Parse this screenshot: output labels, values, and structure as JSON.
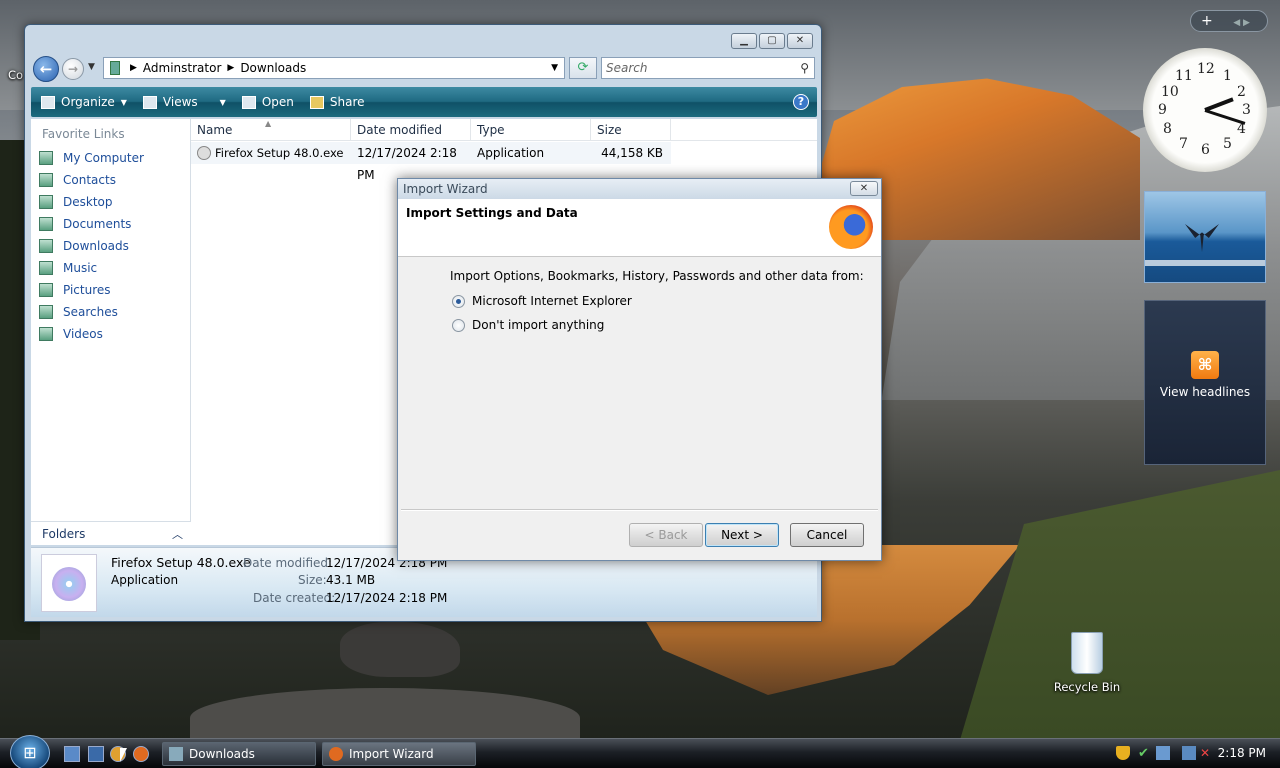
{
  "desktop": {
    "partial_icon_label": "Co",
    "recycle_bin": "Recycle Bin"
  },
  "explorer": {
    "breadcrumb": [
      "Adminstrator",
      "Downloads"
    ],
    "search_placeholder": "Search",
    "toolbar": {
      "organize": "Organize",
      "views": "Views",
      "open": "Open",
      "share": "Share"
    },
    "favorite_links_title": "Favorite Links",
    "links": [
      "My Computer",
      "Contacts",
      "Desktop",
      "Documents",
      "Downloads",
      "Music",
      "Pictures",
      "Searches",
      "Videos"
    ],
    "folders_label": "Folders",
    "columns": [
      "Name",
      "Date modified",
      "Type",
      "Size"
    ],
    "files": [
      {
        "name": "Firefox Setup 48.0.exe",
        "modified": "12/17/2024 2:18 PM",
        "type": "Application",
        "size": "44,158 KB"
      }
    ],
    "details": {
      "filename": "Firefox Setup 48.0.exe",
      "filetype": "Application",
      "date_modified_label": "Date modified:",
      "date_modified": "12/17/2024 2:18 PM",
      "size_label": "Size:",
      "size": "43.1 MB",
      "date_created_label": "Date created:",
      "date_created": "12/17/2024 2:18 PM"
    }
  },
  "wizard": {
    "title": "Import Wizard",
    "heading": "Import Settings and Data",
    "prompt": "Import Options, Bookmarks, History, Passwords and other data from:",
    "options": [
      {
        "label": "Microsoft Internet Explorer",
        "selected": true
      },
      {
        "label": "Don't import anything",
        "selected": false
      }
    ],
    "back": "< Back",
    "next": "Next >",
    "cancel": "Cancel"
  },
  "gadgets": {
    "add": "+",
    "clock_numbers": [
      "12",
      "1",
      "2",
      "3",
      "4",
      "5",
      "6",
      "7",
      "8",
      "9",
      "10",
      "11"
    ],
    "clock_time": "2:18",
    "feeds_label": "View headlines"
  },
  "taskbar": {
    "tasks": [
      "Downloads",
      "Import Wizard"
    ],
    "clock": "2:18 PM"
  },
  "colors": {
    "toolbar": "#1f6a82",
    "link": "#1e4e9a",
    "accent": "#2a62b0"
  }
}
